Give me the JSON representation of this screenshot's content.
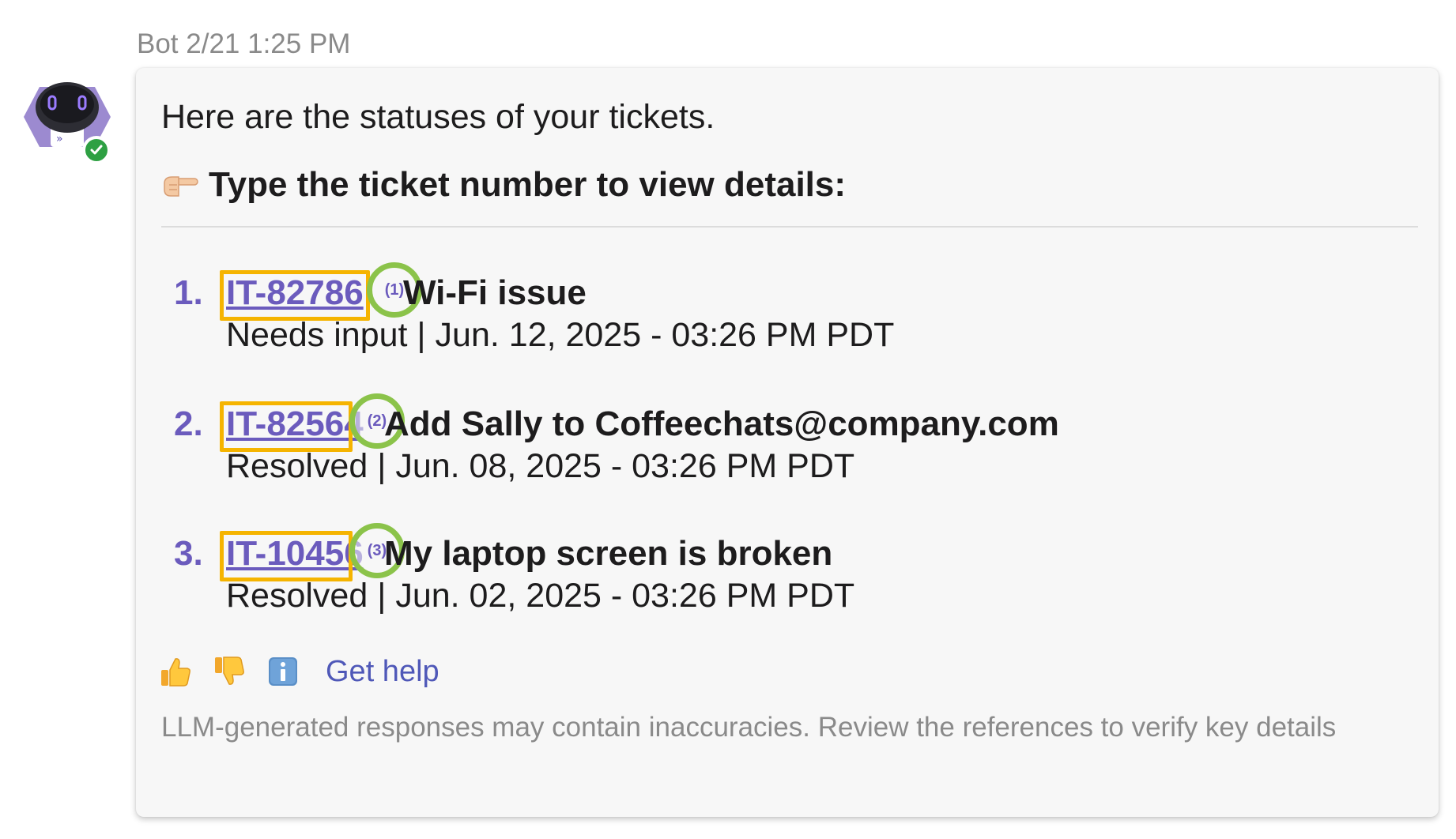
{
  "message": {
    "sender": "Bot",
    "timestamp": "Bot 2/21 1:25 PM",
    "intro": "Here are the statuses of your tickets.",
    "prompt_icon": "pointing-hand-icon",
    "prompt": "Type the ticket number to view details:"
  },
  "avatar": {
    "icon": "robot-avatar-icon",
    "status": "online",
    "status_color": "#2ea043"
  },
  "tickets": [
    {
      "number": "1.",
      "id": "IT-82786",
      "marker": "(1)",
      "title": "Wi-Fi issue",
      "status_line": "Needs input | Jun. 12, 2025 - 03:26 PM PDT"
    },
    {
      "number": "2.",
      "id": "IT-82564",
      "marker": "(2)",
      "title": "Add Sally to Coffeechats@company.com",
      "status_line": "Resolved | Jun. 08, 2025 - 03:26 PM PDT"
    },
    {
      "number": "3.",
      "id": "IT-10456",
      "marker": "(3)",
      "title": "My laptop screen is broken",
      "status_line": "Resolved | Jun. 02, 2025 - 03:26 PM PDT"
    }
  ],
  "actions": {
    "thumbs_up_icon": "thumbs-up-icon",
    "thumbs_down_icon": "thumbs-down-icon",
    "info_icon": "info-icon",
    "help_label": "Get help"
  },
  "disclaimer": "LLM-generated responses may contain inaccuracies. Review the references to verify key details",
  "colors": {
    "link": "#6b5bbd",
    "highlight_box": "#f5b400",
    "marker_ring": "#8bc34a",
    "help_link": "#4f58b8"
  }
}
